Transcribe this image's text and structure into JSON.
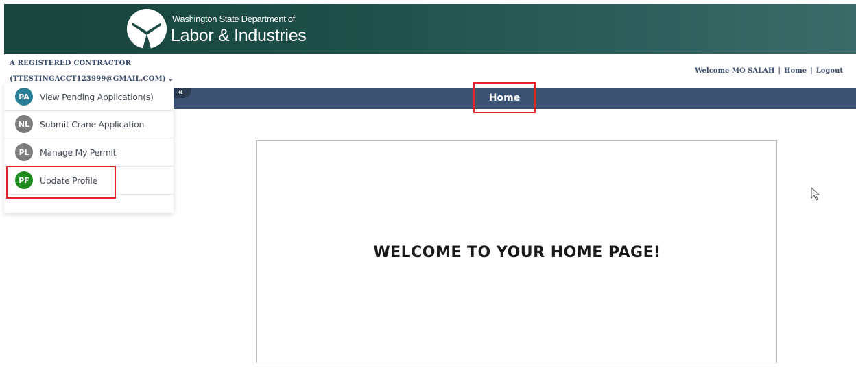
{
  "header": {
    "org_small": "Washington State Department of",
    "org_big": "Labor & Industries"
  },
  "account": {
    "line1": "A REGISTERED CONTRACTOR",
    "line2": "(TTESTINGACCT123999@GMAIL.COM)",
    "chevron": "⌄"
  },
  "top_links": {
    "welcome": "Welcome MO SALAH",
    "separator": "|",
    "home": "Home",
    "logout": "Logout"
  },
  "nav": {
    "collapse_icon": "«",
    "title": "Home"
  },
  "menu": {
    "items": [
      {
        "badge": "PA",
        "label": "View Pending Application(s)",
        "color": "#2a7f97"
      },
      {
        "badge": "NL",
        "label": "Submit Crane Application",
        "color": "#7d7d7d"
      },
      {
        "badge": "PL",
        "label": "Manage My Permit",
        "color": "#7d7d7d"
      },
      {
        "badge": "PF",
        "label": "Update Profile",
        "color": "#1f8a1f"
      }
    ]
  },
  "content": {
    "welcome": "WELCOME TO YOUR HOME PAGE!"
  },
  "colors": {
    "header_dark": "#17443d",
    "header_light": "#3c6a68",
    "nav_bar": "#3b5272",
    "highlight": "#e0252b",
    "account_text": "#3a4c6b"
  }
}
